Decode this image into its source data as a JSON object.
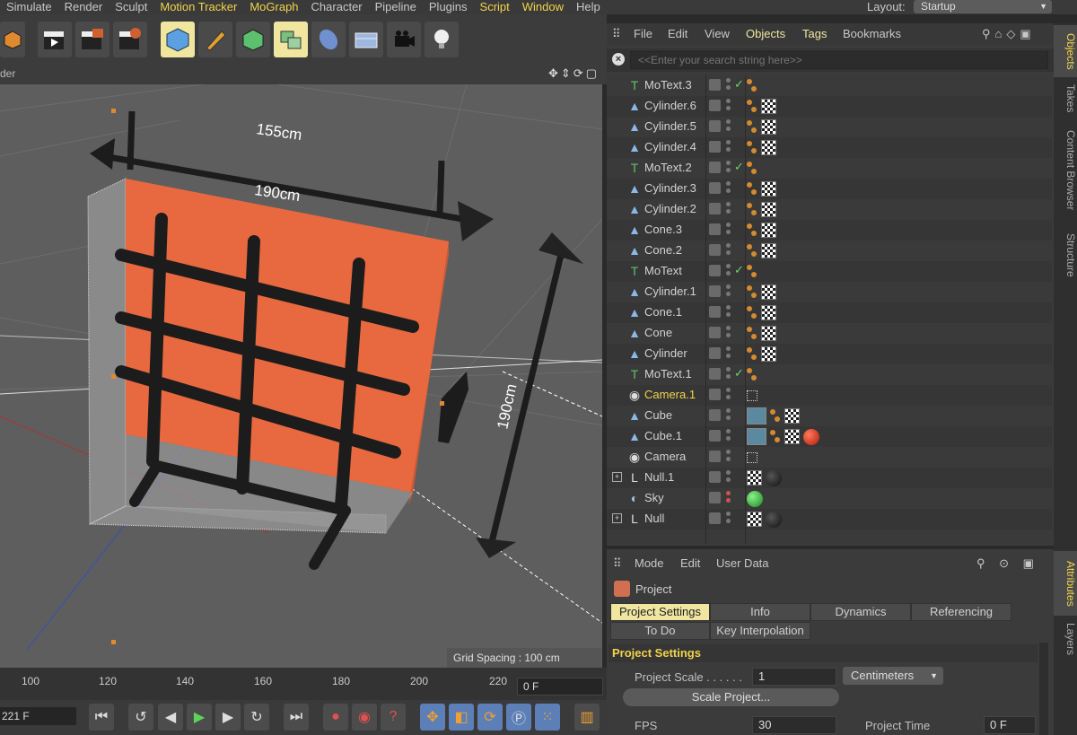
{
  "menubar": {
    "items": [
      {
        "label": "Simulate",
        "hl": false
      },
      {
        "label": "Render",
        "hl": false
      },
      {
        "label": "Sculpt",
        "hl": false
      },
      {
        "label": "Motion Tracker",
        "hl": true
      },
      {
        "label": "MoGraph",
        "hl": true
      },
      {
        "label": "Character",
        "hl": false
      },
      {
        "label": "Pipeline",
        "hl": false
      },
      {
        "label": "Plugins",
        "hl": false
      },
      {
        "label": "Script",
        "hl": true
      },
      {
        "label": "Window",
        "hl": true
      },
      {
        "label": "Help",
        "hl": false
      }
    ],
    "layout_label": "Layout:",
    "layout_value": "Startup"
  },
  "viewport": {
    "header_label": "der",
    "grid_spacing": "Grid Spacing : 100 cm",
    "dimension_labels": [
      "155cm",
      "190cm",
      "190cm"
    ]
  },
  "timeline": {
    "ticks": [
      "100",
      "120",
      "140",
      "160",
      "180",
      "200",
      "220"
    ],
    "frame_field": "0 F",
    "current_frame": "221 F"
  },
  "objects": {
    "menu": [
      {
        "label": "File",
        "hl": false
      },
      {
        "label": "Edit",
        "hl": false
      },
      {
        "label": "View",
        "hl": false
      },
      {
        "label": "Objects",
        "hl": true
      },
      {
        "label": "Tags",
        "hl": true
      },
      {
        "label": "Bookmarks",
        "hl": false
      }
    ],
    "search_placeholder": "<<Enter your search string here>>",
    "rows": [
      {
        "name": "MoText.3",
        "icon": "T",
        "check": true,
        "tags": "or"
      },
      {
        "name": "Cylinder.6",
        "icon": "cyl",
        "check": false,
        "tags": "or-ck"
      },
      {
        "name": "Cylinder.5",
        "icon": "cyl",
        "check": false,
        "tags": "or-ck"
      },
      {
        "name": "Cylinder.4",
        "icon": "cyl",
        "check": false,
        "tags": "or-ck"
      },
      {
        "name": "MoText.2",
        "icon": "T",
        "check": true,
        "tags": "or"
      },
      {
        "name": "Cylinder.3",
        "icon": "cyl",
        "check": false,
        "tags": "or-ck"
      },
      {
        "name": "Cylinder.2",
        "icon": "cyl",
        "check": false,
        "tags": "or-ck"
      },
      {
        "name": "Cone.3",
        "icon": "cyl",
        "check": false,
        "tags": "or-ck"
      },
      {
        "name": "Cone.2",
        "icon": "cyl",
        "check": false,
        "tags": "or-ck"
      },
      {
        "name": "MoText",
        "icon": "T",
        "check": true,
        "tags": "or"
      },
      {
        "name": "Cylinder.1",
        "icon": "cyl",
        "check": false,
        "tags": "or-ck"
      },
      {
        "name": "Cone.1",
        "icon": "cyl",
        "check": false,
        "tags": "or-ck"
      },
      {
        "name": "Cone",
        "icon": "cyl",
        "check": false,
        "tags": "or-ck"
      },
      {
        "name": "Cylinder",
        "icon": "cyl",
        "check": false,
        "tags": "or-ck"
      },
      {
        "name": "MoText.1",
        "icon": "T",
        "check": true,
        "tags": "or"
      },
      {
        "name": "Camera.1",
        "icon": "cam",
        "check": false,
        "tags": "cam",
        "selected": true
      },
      {
        "name": "Cube",
        "icon": "cyl",
        "check": false,
        "tags": "tex-or-ck"
      },
      {
        "name": "Cube.1",
        "icon": "cyl",
        "check": false,
        "tags": "tex-or-ck-red"
      },
      {
        "name": "Camera",
        "icon": "cam",
        "check": false,
        "tags": "cam"
      },
      {
        "name": "Null.1",
        "icon": "null",
        "check": false,
        "tags": "black",
        "expand": true
      },
      {
        "name": "Sky",
        "icon": "sky",
        "check": false,
        "tags": "green",
        "reddot": true
      },
      {
        "name": "Null",
        "icon": "null",
        "check": false,
        "tags": "black",
        "expand": true
      }
    ]
  },
  "attributes": {
    "menu": [
      "Mode",
      "Edit",
      "User Data"
    ],
    "title": "Project",
    "tabs_row1": [
      "Project Settings",
      "Info",
      "Dynamics",
      "Referencing"
    ],
    "tabs_row2": [
      "To Do",
      "Key Interpolation"
    ],
    "section": "Project Settings",
    "project_scale_label": "Project Scale . . . . . .",
    "project_scale_value": "1",
    "units": "Centimeters",
    "scale_button": "Scale Project...",
    "fps_label": "FPS",
    "fps_value": "30",
    "project_time_label": "Project Time",
    "project_time_value": "0 F"
  },
  "side_tabs": [
    "Objects",
    "Takes",
    "Content Browser",
    "Structure",
    "Attributes",
    "Layers"
  ]
}
